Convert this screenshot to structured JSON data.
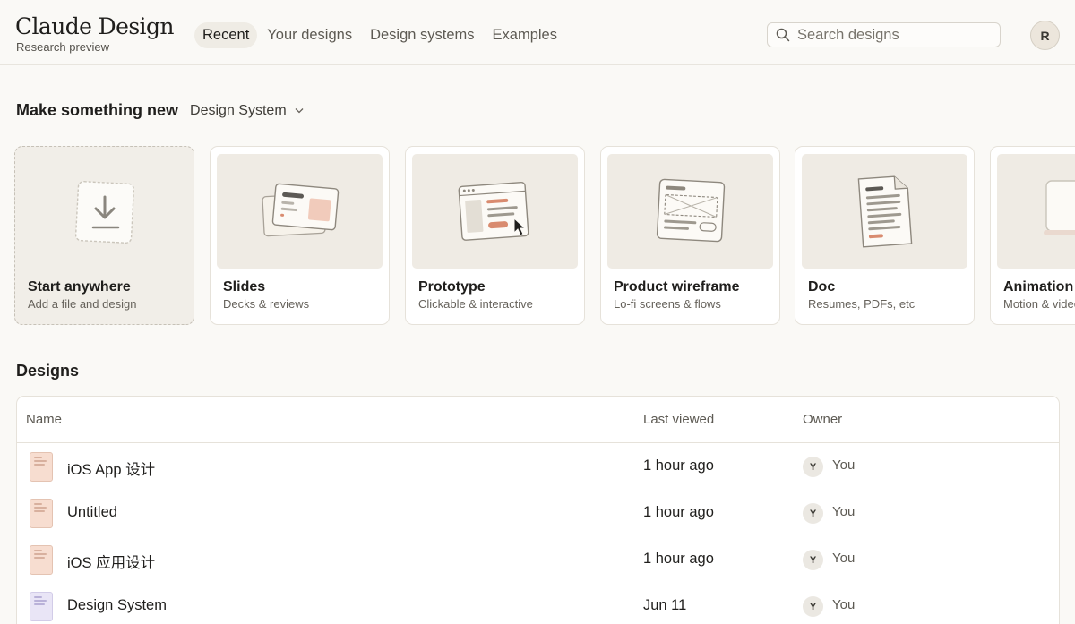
{
  "app": {
    "name": "Claude Design",
    "subtitle": "Research preview"
  },
  "nav": {
    "tabs": [
      {
        "label": "Recent",
        "active": true
      },
      {
        "label": "Your designs",
        "active": false
      },
      {
        "label": "Design systems",
        "active": false
      },
      {
        "label": "Examples",
        "active": false
      }
    ]
  },
  "search": {
    "placeholder": "Search designs",
    "value": ""
  },
  "user": {
    "initial": "R"
  },
  "make_new": {
    "title": "Make something new",
    "design_system_select": "Design System",
    "cards": [
      {
        "title": "Start anywhere",
        "subtitle": "Add a file and design",
        "icon": "download-icon"
      },
      {
        "title": "Slides",
        "subtitle": "Decks & reviews",
        "icon": "slides-illustration"
      },
      {
        "title": "Prototype",
        "subtitle": "Clickable & interactive",
        "icon": "prototype-illustration"
      },
      {
        "title": "Product wireframe",
        "subtitle": "Lo-fi screens & flows",
        "icon": "wireframe-illustration"
      },
      {
        "title": "Doc",
        "subtitle": "Resumes, PDFs, etc",
        "icon": "doc-illustration"
      },
      {
        "title": "Animation",
        "subtitle": "Motion & video",
        "icon": "animation-illustration"
      }
    ]
  },
  "designs": {
    "title": "Designs",
    "columns": {
      "name": "Name",
      "last_viewed": "Last viewed",
      "owner": "Owner"
    },
    "rows": [
      {
        "name": "iOS App 设计",
        "last_viewed": "1 hour ago",
        "owner_initial": "Y",
        "owner": "You",
        "color": "#f7ddd0"
      },
      {
        "name": "Untitled",
        "last_viewed": "1 hour ago",
        "owner_initial": "Y",
        "owner": "You",
        "color": "#f7ddd0"
      },
      {
        "name": "iOS 应用设计",
        "last_viewed": "1 hour ago",
        "owner_initial": "Y",
        "owner": "You",
        "color": "#f7ddd0"
      },
      {
        "name": "Design System",
        "last_viewed": "Jun 11",
        "owner_initial": "Y",
        "owner": "You",
        "color": "#e9e5f6"
      }
    ]
  },
  "colors": {
    "background": "#faf9f6",
    "accent": "#d98b6f",
    "border": "#e6e2da"
  }
}
